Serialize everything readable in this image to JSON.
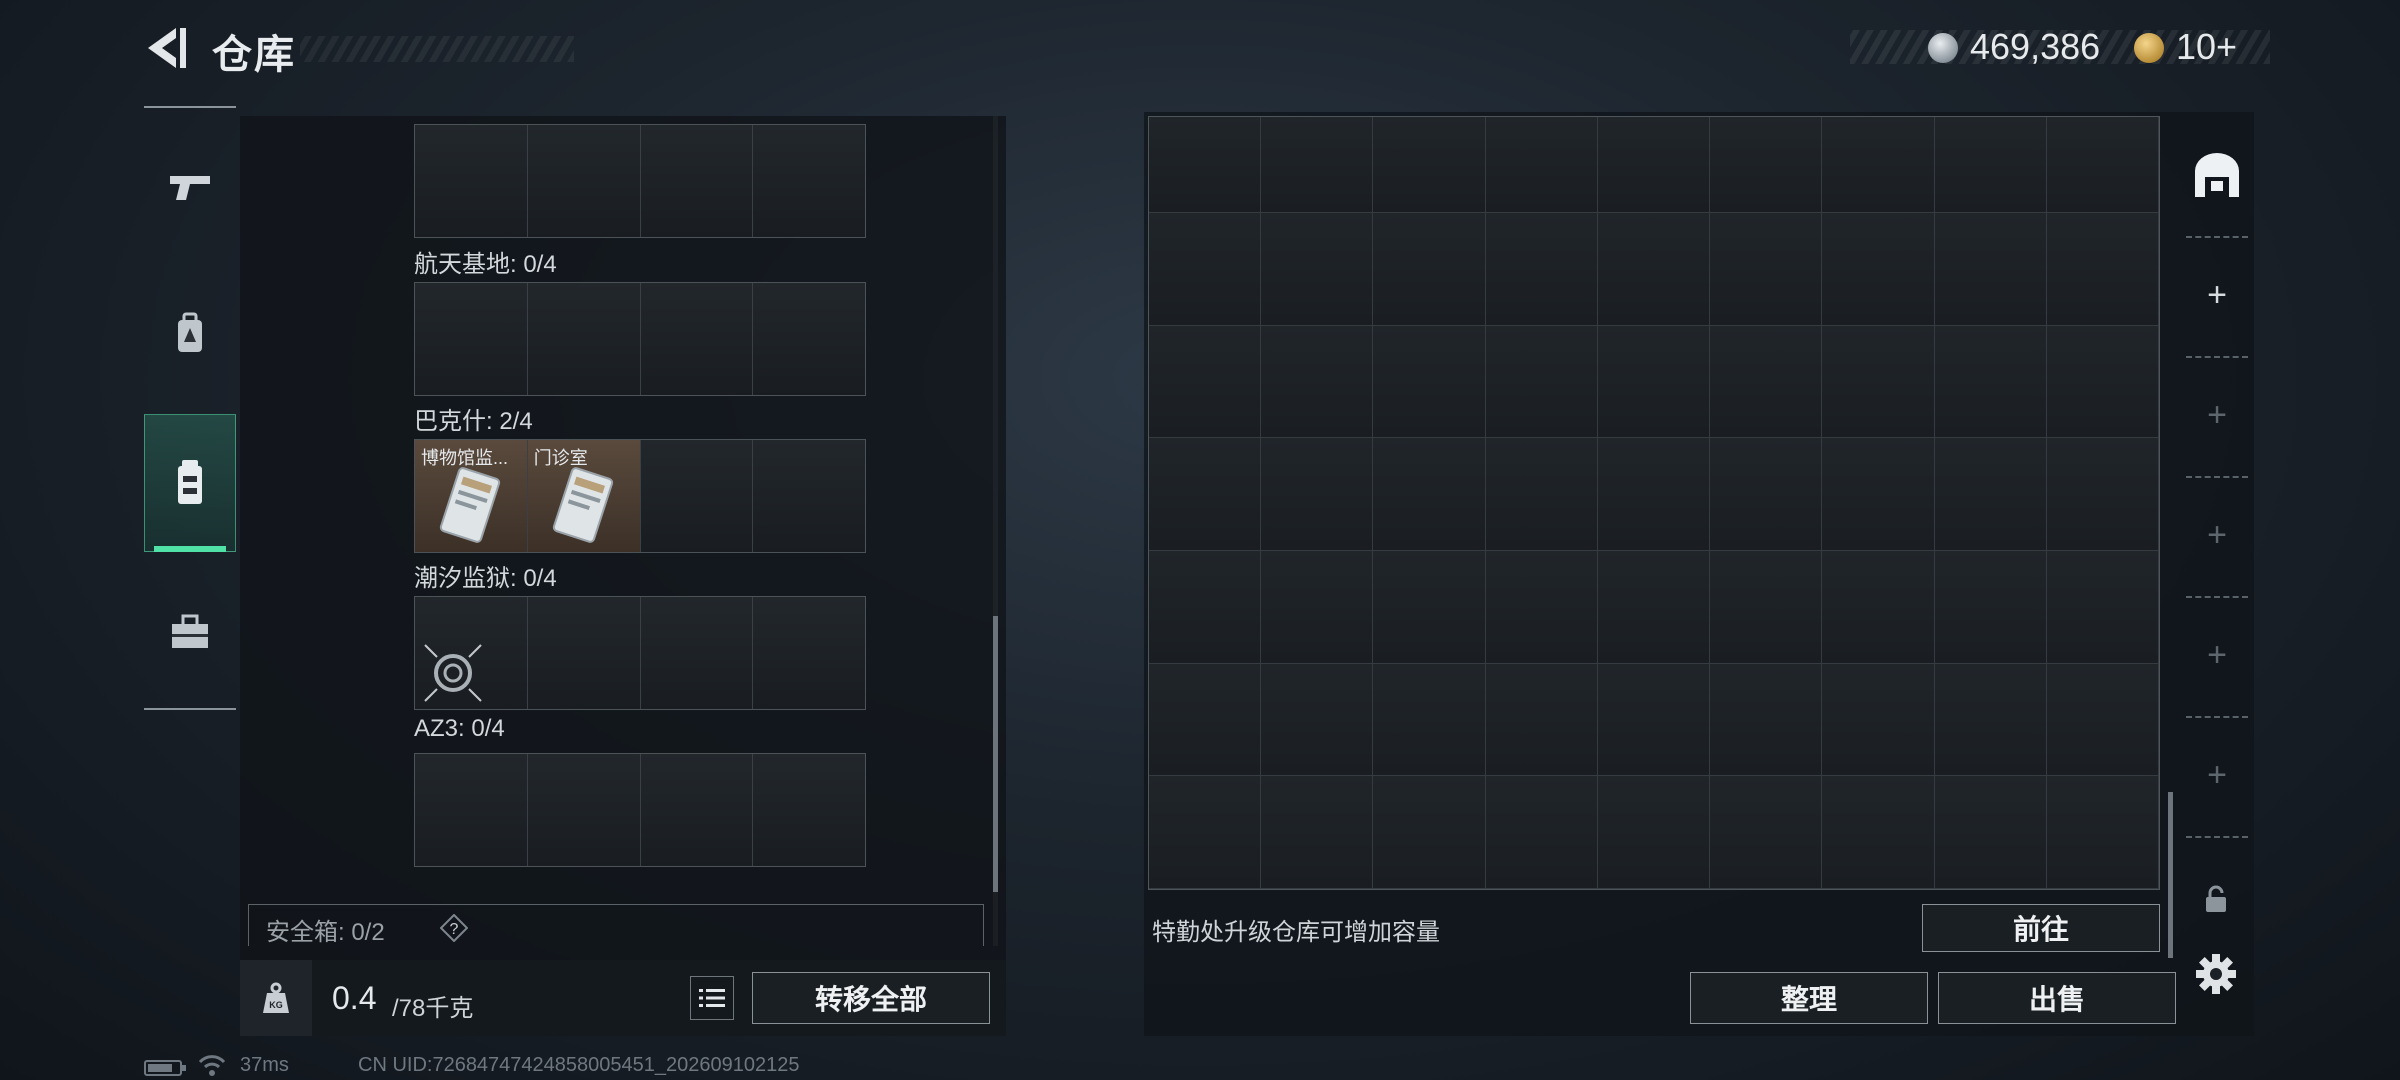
{
  "header": {
    "title": "仓库",
    "currency": {
      "coin_value": "469,386",
      "token_value": "10+",
      "coin_icon": "silver-coin-icon",
      "token_icon": "gold-token-icon"
    }
  },
  "left_nav": {
    "items": [
      {
        "name": "weapons",
        "icon": "pistol-icon"
      },
      {
        "name": "equipment",
        "icon": "backpack-icon"
      },
      {
        "name": "keys",
        "icon": "keycard-case-icon",
        "active": true
      },
      {
        "name": "tools",
        "icon": "toolbox-icon"
      }
    ]
  },
  "key_rows": [
    {
      "label": "",
      "cells": []
    },
    {
      "label": "航天基地: 0/4",
      "cells": []
    },
    {
      "label": "巴克什: 2/4",
      "cells": [
        {
          "name": "博物馆监..."
        },
        {
          "name": "门诊室"
        }
      ]
    },
    {
      "label": "潮汐监狱: 0/4",
      "cells": []
    },
    {
      "label": "AZ3: 0/4",
      "cells": []
    }
  ],
  "safebox": {
    "label": "安全箱: 0/2",
    "help": "?"
  },
  "weight": {
    "current": "0.4",
    "total": "/78千克",
    "kg_label": "KG"
  },
  "buttons": {
    "transfer_all": "转移全部",
    "goto": "前往",
    "sort": "整理",
    "sell": "出售"
  },
  "upgrade_hint": "特勤处升级仓库可增加容量",
  "storage_grid": {
    "columns": 9,
    "rows": 7
  },
  "side_tabs": [
    {
      "icon": "warehouse-icon",
      "label": "",
      "enabled": true
    },
    {
      "icon": "plus-icon",
      "label": "+",
      "enabled": true
    },
    {
      "icon": "plus-icon",
      "label": "+",
      "enabled": false
    },
    {
      "icon": "plus-icon",
      "label": "+",
      "enabled": false
    },
    {
      "icon": "plus-icon",
      "label": "+",
      "enabled": false
    },
    {
      "icon": "plus-icon",
      "label": "+",
      "enabled": false
    }
  ],
  "status_bar": {
    "ping": "37ms",
    "uid": "CN UID:726847474248580054​51_202609102125"
  }
}
